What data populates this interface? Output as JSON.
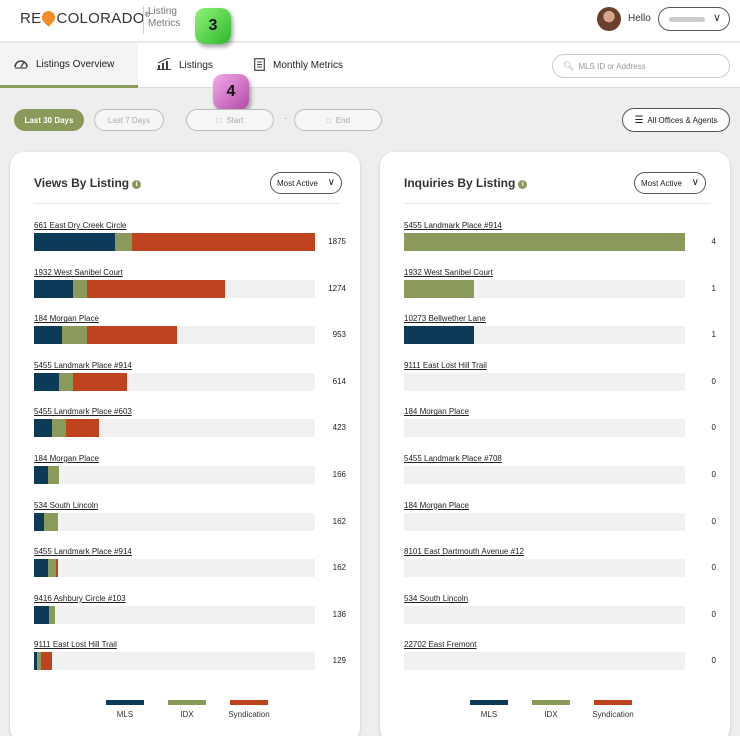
{
  "header": {
    "logo_left": "RE",
    "logo_right": "COLORADO",
    "logo_reg": "®",
    "subtitle": "Listing Metrics",
    "greeting": "Hello"
  },
  "callouts": {
    "green": "3",
    "purple": "4"
  },
  "nav": {
    "tabs": [
      {
        "label": "Listings Overview",
        "icon": "dashboard-icon"
      },
      {
        "label": "Listings",
        "icon": "chart-icon"
      },
      {
        "label": "Monthly Metrics",
        "icon": "document-icon"
      }
    ],
    "search_placeholder": "MLS ID or Address"
  },
  "filters": {
    "last30": "Last 30 Days",
    "last7": "Last 7 Days",
    "start": "Start",
    "end": "End",
    "separator": "·",
    "offices": "All Offices & Agents"
  },
  "colors": {
    "mls": "#0d3a56",
    "idx": "#8a9a5b",
    "syndication": "#c0431f"
  },
  "views": {
    "title": "Views By Listing",
    "sort": "Most Active",
    "legend": [
      "MLS",
      "IDX",
      "Syndication"
    ],
    "max": 1875,
    "rows": [
      {
        "name": "661 East Dry Creek Circle",
        "total": "1875",
        "mls": 0.29,
        "idx": 0.06,
        "synd": 0.65
      },
      {
        "name": "1932 West Sanibel Court",
        "total": "1274",
        "mls": 0.14,
        "idx": 0.05,
        "synd": 0.49
      },
      {
        "name": "184 Morgan Place",
        "total": "953",
        "mls": 0.1,
        "idx": 0.09,
        "synd": 0.32
      },
      {
        "name": "5455 Landmark Place #914",
        "total": "614",
        "mls": 0.09,
        "idx": 0.05,
        "synd": 0.19
      },
      {
        "name": "5455 Landmark Place #603",
        "total": "423",
        "mls": 0.065,
        "idx": 0.05,
        "synd": 0.115
      },
      {
        "name": "184 Morgan Place",
        "total": "166",
        "mls": 0.05,
        "idx": 0.04,
        "synd": 0
      },
      {
        "name": "534 South Lincoln",
        "total": "162",
        "mls": 0.035,
        "idx": 0.05,
        "synd": 0
      },
      {
        "name": "5455 Landmark Place #914",
        "total": "162",
        "mls": 0.05,
        "idx": 0.03,
        "synd": 0.005
      },
      {
        "name": "9416 Ashbury Circle #103",
        "total": "136",
        "mls": 0.055,
        "idx": 0.02,
        "synd": 0
      },
      {
        "name": "9111 East Lost Hill Trail",
        "total": "129",
        "mls": 0.01,
        "idx": 0.015,
        "synd": 0.04
      }
    ]
  },
  "inquiries": {
    "title": "Inquiries By Listing",
    "sort": "Most Active",
    "legend": [
      "MLS",
      "IDX",
      "Syndication"
    ],
    "max": 4,
    "rows": [
      {
        "name": "5455 Landmark Place #914",
        "total": "4",
        "mls": 0,
        "idx": 1.0,
        "synd": 0
      },
      {
        "name": "1932 West Sanibel Court",
        "total": "1",
        "mls": 0,
        "idx": 0.25,
        "synd": 0
      },
      {
        "name": "10273 Bellwether Lane",
        "total": "1",
        "mls": 0.25,
        "idx": 0,
        "synd": 0
      },
      {
        "name": "9111 East Lost Hill Trail",
        "total": "0",
        "mls": 0,
        "idx": 0,
        "synd": 0
      },
      {
        "name": "184 Morgan Place",
        "total": "0",
        "mls": 0,
        "idx": 0,
        "synd": 0
      },
      {
        "name": "5455 Landmark Place #708",
        "total": "0",
        "mls": 0,
        "idx": 0,
        "synd": 0
      },
      {
        "name": "184 Morgan Place",
        "total": "0",
        "mls": 0,
        "idx": 0,
        "synd": 0
      },
      {
        "name": "8101 East Dartmouth Avenue #12",
        "total": "0",
        "mls": 0,
        "idx": 0,
        "synd": 0
      },
      {
        "name": "534 South Lincoln",
        "total": "0",
        "mls": 0,
        "idx": 0,
        "synd": 0
      },
      {
        "name": "22702 East Fremont",
        "total": "0",
        "mls": 0,
        "idx": 0,
        "synd": 0
      }
    ]
  }
}
